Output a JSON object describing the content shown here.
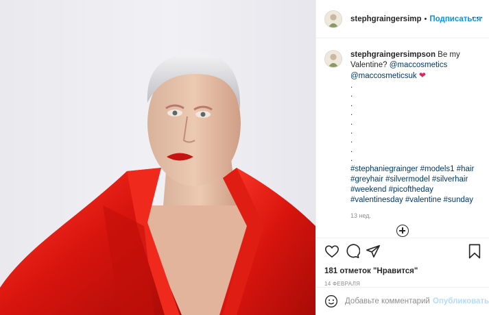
{
  "header": {
    "username": "stephgraingersimp",
    "separator": "•",
    "follow_label": "Подписаться",
    "more_label": "···"
  },
  "caption": {
    "username": "stephgraingersimpson",
    "text_before": "Be my Valentine?",
    "mentions": [
      "@maccosmetics",
      "@maccosmeticsuk"
    ],
    "emoji": "❤",
    "dots": [
      ".",
      ".",
      ".",
      ".",
      ".",
      ".",
      ".",
      ".",
      "."
    ],
    "hashtags_line": "#stephaniegrainger #models1 #hair #greyhair #silvermodel #silverhair #weekend #picoftheday #valentinesday #valentine #sunday",
    "time_ago": "13 нед."
  },
  "actions": {
    "like_icon": "heart-icon",
    "comment_icon": "comment-icon",
    "share_icon": "share-icon",
    "save_icon": "bookmark-icon",
    "likes_text": "181 отметок \"Нравится\"",
    "date": "14 ФЕВРАЛЯ"
  },
  "comment_box": {
    "placeholder": "Добавьте комментарий...",
    "publish_label": "Опубликовать",
    "emoji_icon": "smiley-icon"
  },
  "colors": {
    "link_blue": "#0095f6",
    "hashtag_blue": "#00376b",
    "muted": "#8e8e8e",
    "publish_disabled": "#b3dbff",
    "heart_red": "#e0245e"
  }
}
